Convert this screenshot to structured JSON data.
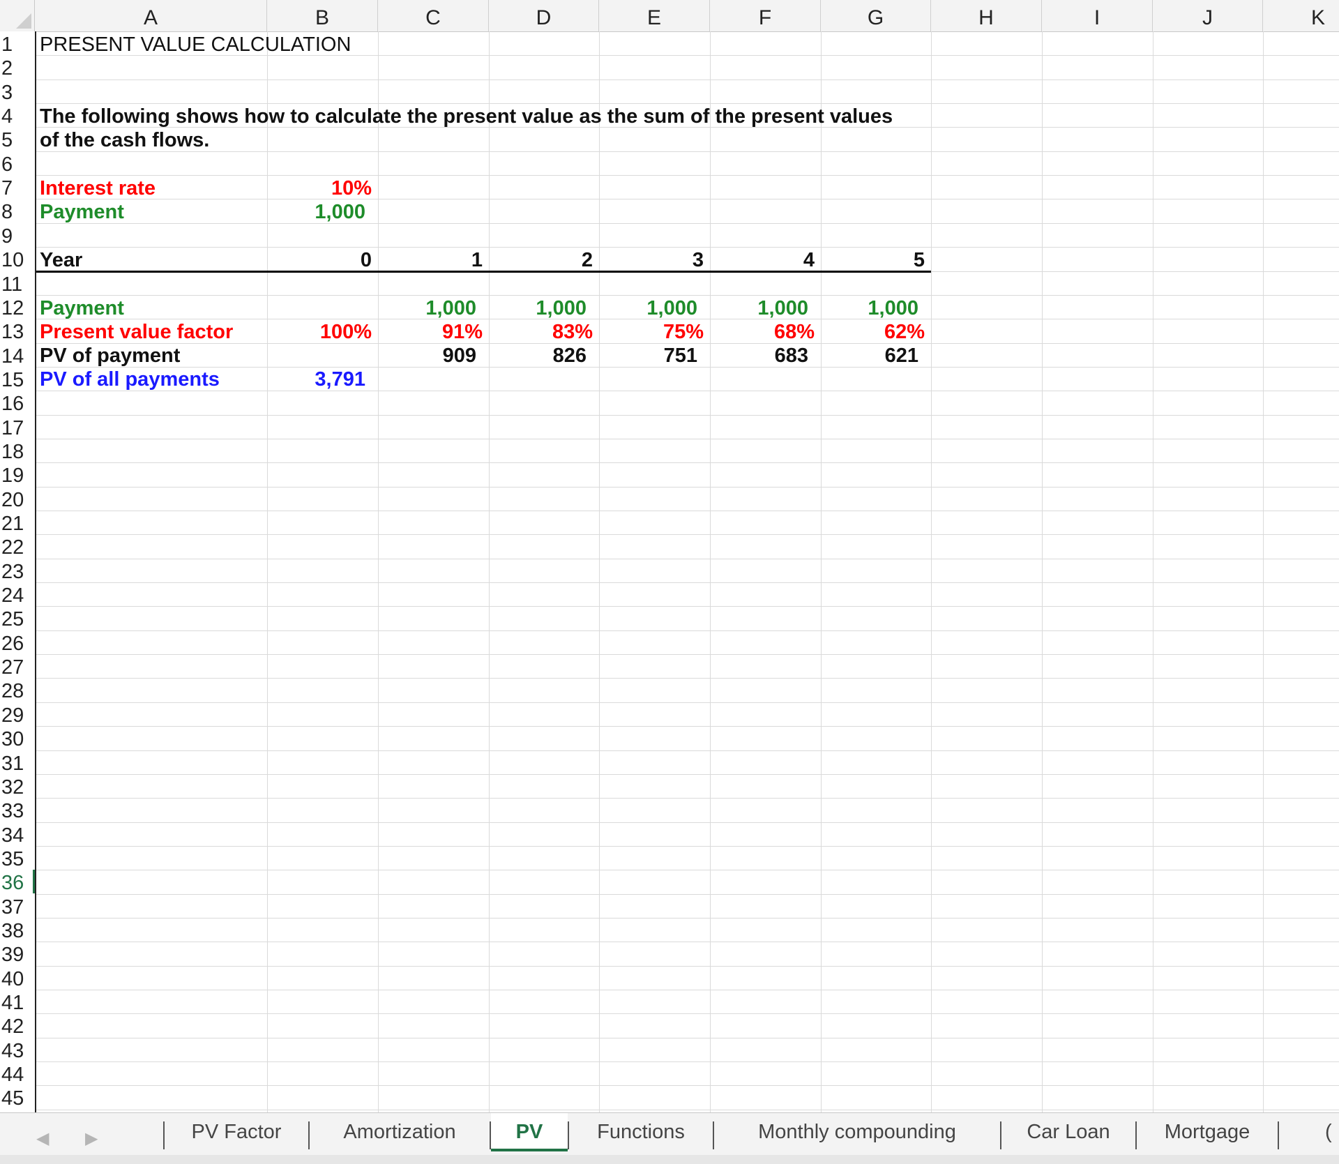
{
  "columns": [
    "A",
    "B",
    "C",
    "D",
    "E",
    "F",
    "G",
    "H",
    "I",
    "J",
    "K"
  ],
  "row_numbers": [
    "1",
    "2",
    "3",
    "4",
    "5",
    "6",
    "7",
    "8",
    "9",
    "10",
    "11",
    "12",
    "13",
    "14",
    "15",
    "16",
    "17",
    "18",
    "19",
    "20",
    "21",
    "22",
    "23",
    "24",
    "25",
    "26",
    "27",
    "28",
    "29",
    "30",
    "31",
    "32",
    "33",
    "34",
    "35",
    "36",
    "37",
    "38",
    "39",
    "40",
    "41",
    "42",
    "43",
    "44",
    "45"
  ],
  "active_row": "36",
  "cells": {
    "title": "PRESENT VALUE CALCULATION",
    "desc_line1": "The following shows how to calculate the present value as the sum of the present values",
    "desc_line2": "of the cash flows.",
    "interest_label": "Interest rate",
    "interest_value": "10%",
    "payment_label": "Payment",
    "payment_value": "1,000",
    "year_label": "Year",
    "years": [
      "0",
      "1",
      "2",
      "3",
      "4",
      "5"
    ],
    "payment_row_label": "Payment",
    "payments": [
      "1,000",
      "1,000",
      "1,000",
      "1,000",
      "1,000"
    ],
    "pv_factor_label": "Present value factor",
    "pv_factors": [
      "100%",
      "91%",
      "83%",
      "75%",
      "68%",
      "62%"
    ],
    "pv_payment_label": "PV of payment",
    "pv_payments": [
      "909",
      "826",
      "751",
      "683",
      "621"
    ],
    "pv_all_label": "PV of all payments",
    "pv_all_value": "3,791"
  },
  "sheet_tabs": [
    {
      "label": "PV Factor",
      "active": false
    },
    {
      "label": "Amortization",
      "active": false
    },
    {
      "label": "PV",
      "active": true
    },
    {
      "label": "Functions",
      "active": false
    },
    {
      "label": "Monthly compounding",
      "active": false
    },
    {
      "label": "Car Loan",
      "active": false
    },
    {
      "label": "Mortgage",
      "active": false
    }
  ],
  "tab_overflow": "(",
  "nav": {
    "prev_icon": "triangle-left",
    "next_icon": "triangle-right"
  },
  "colors": {
    "green_accent": "#217346",
    "red": "#ff0000",
    "green": "#1e8c2a",
    "blue": "#1a1aff"
  }
}
